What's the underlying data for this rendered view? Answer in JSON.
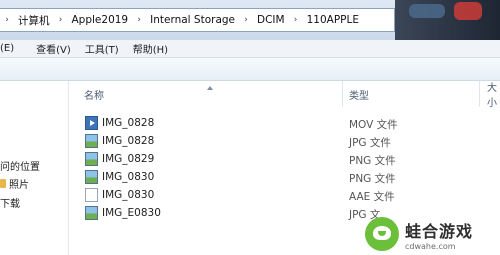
{
  "breadcrumb": {
    "items": [
      "计算机",
      "Apple2019",
      "Internal Storage",
      "DCIM",
      "110APPLE"
    ]
  },
  "menubar": {
    "items": [
      "(E)",
      "查看(V)",
      "工具(T)",
      "帮助(H)"
    ]
  },
  "navpane": {
    "items": [
      "问的位置",
      "照片",
      "下载"
    ]
  },
  "filelist": {
    "columns": {
      "name": "名称",
      "type": "类型",
      "size": "大小"
    },
    "rows": [
      {
        "name": "IMG_0828",
        "type": "MOV 文件",
        "icon": "video-file-icon"
      },
      {
        "name": "IMG_0828",
        "type": "JPG 文件",
        "icon": "image-file-icon"
      },
      {
        "name": "IMG_0829",
        "type": "PNG 文件",
        "icon": "image-file-icon"
      },
      {
        "name": "IMG_0830",
        "type": "PNG 文件",
        "icon": "image-file-icon"
      },
      {
        "name": "IMG_0830",
        "type": "AAE 文件",
        "icon": "document-file-icon"
      },
      {
        "name": "IMG_E0830",
        "type": "JPG 文",
        "icon": "image-file-icon"
      }
    ]
  },
  "watermark": {
    "cn": "蛙合游戏",
    "en": "cdwahe.com"
  }
}
